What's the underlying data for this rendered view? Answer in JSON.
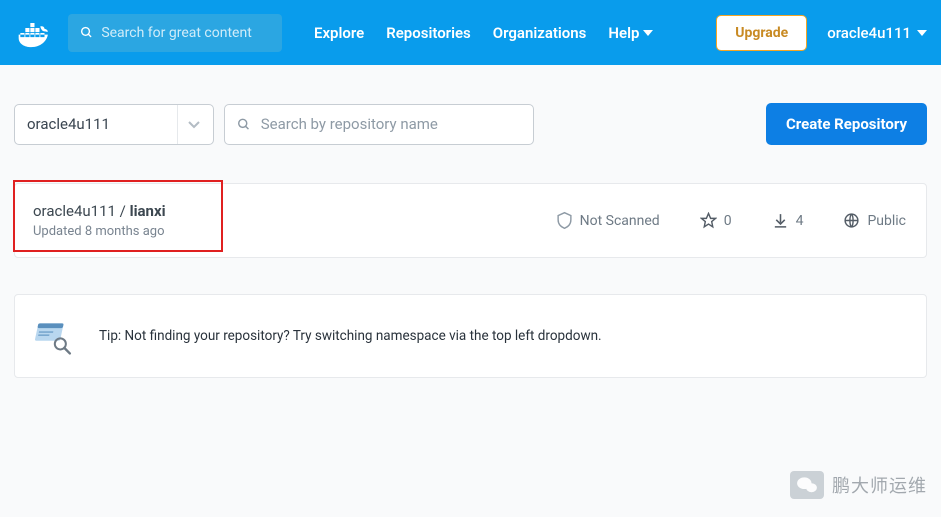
{
  "header": {
    "search_placeholder": "Search for great content",
    "nav": {
      "explore": "Explore",
      "repositories": "Repositories",
      "organizations": "Organizations",
      "help": "Help"
    },
    "upgrade_label": "Upgrade",
    "username": "oracle4u111"
  },
  "controls": {
    "namespace": "oracle4u111",
    "repo_search_placeholder": "Search by repository name",
    "create_label": "Create Repository"
  },
  "repo": {
    "owner": "oracle4u111",
    "sep": " / ",
    "name": "lianxi",
    "updated": "Updated 8 months ago",
    "scanned": "Not Scanned",
    "stars": "0",
    "downloads": "4",
    "visibility": "Public"
  },
  "tip": {
    "text": "Tip: Not finding your repository? Try switching namespace via the top left dropdown."
  },
  "watermark": {
    "text": "鹏大师运维"
  }
}
